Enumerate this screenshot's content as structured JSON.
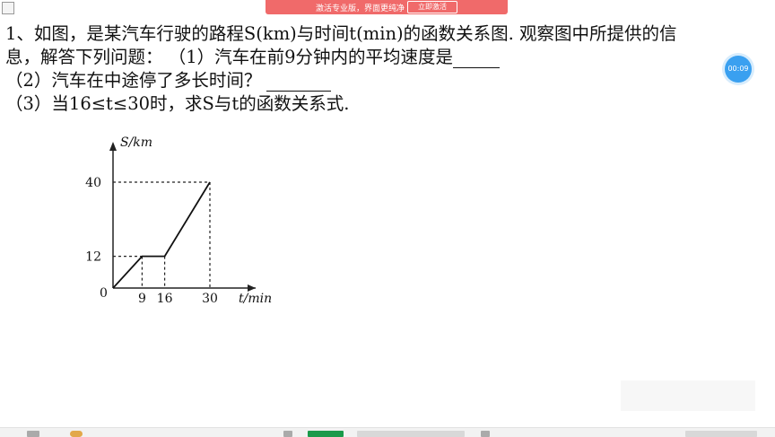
{
  "banner": {
    "text": "激活专业版，界面更纯净",
    "button": "立即激活"
  },
  "timer": "00:09",
  "question": {
    "line1": "1、如图，是某汽车行驶的路程S(km)与时间t(min)的函数关系图. 观察图中所提供的信",
    "line2": "息，解答下列问题：       （1）汽车在前9分钟内的平均速度是",
    "line3": "（2）汽车在中途停了多长时间？",
    "line4": "（3）当16≤t≤30时，求S与t的函数关系式."
  },
  "chart_data": {
    "type": "line",
    "ylabel": "S/km",
    "xlabel": "t/min",
    "origin_label": "0",
    "x_ticks": [
      "9",
      "16",
      "30"
    ],
    "y_ticks": [
      "12",
      "40"
    ],
    "points": [
      [
        0,
        0
      ],
      [
        9,
        12
      ],
      [
        16,
        12
      ],
      [
        30,
        40
      ]
    ]
  }
}
